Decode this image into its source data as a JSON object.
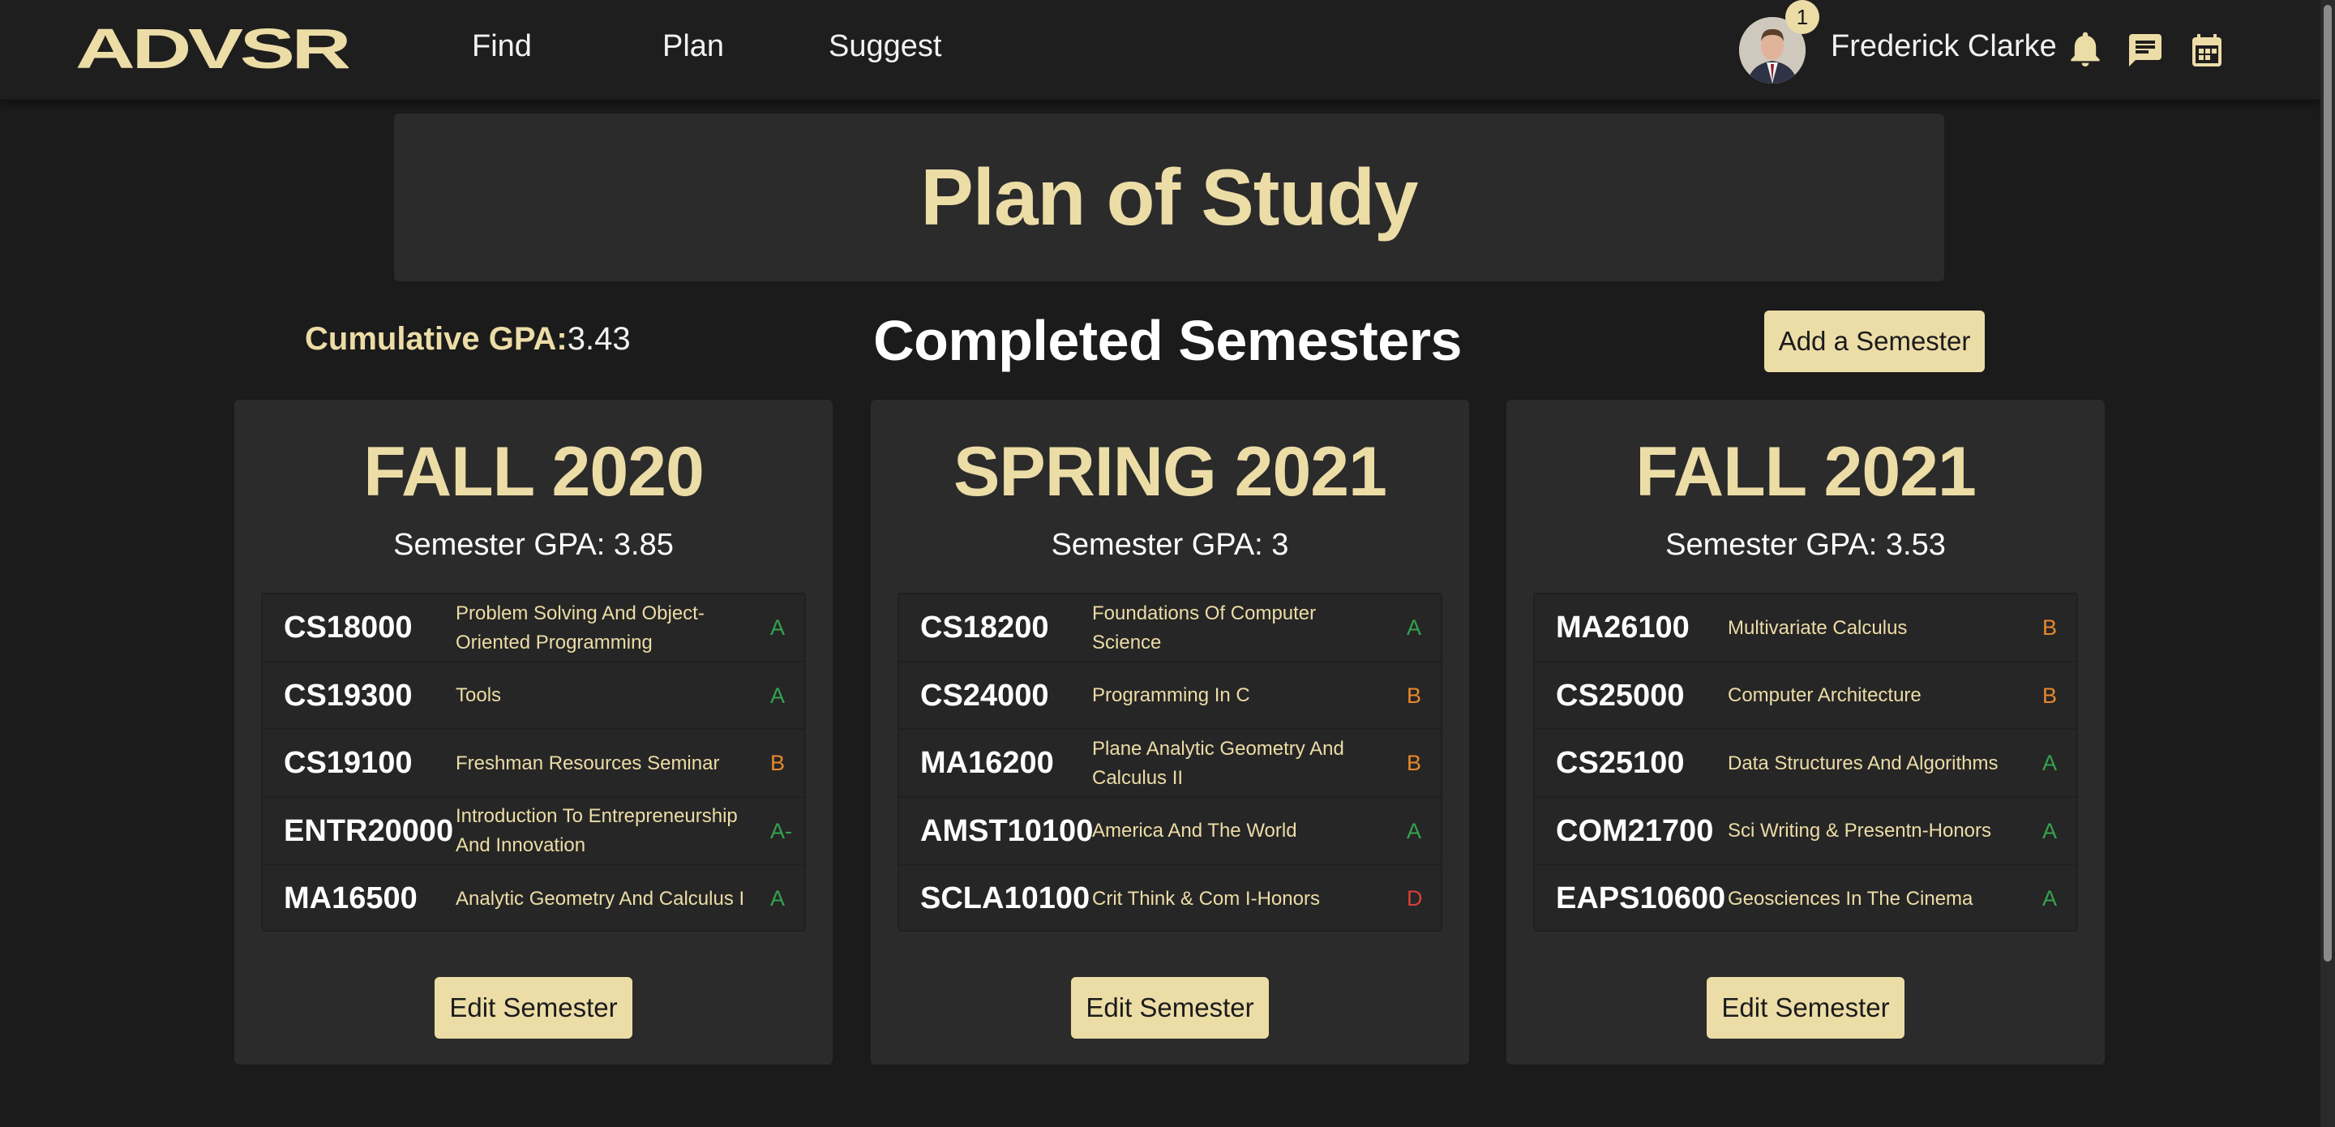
{
  "app": {
    "logo_text": "ADVSR"
  },
  "nav": {
    "find": "Find",
    "plan": "Plan",
    "suggest": "Suggest"
  },
  "user": {
    "name": "Frederick Clarke",
    "notification_count": "1"
  },
  "header_icons": [
    "bell-icon",
    "chat-icon",
    "calendar-icon"
  ],
  "page": {
    "title": "Plan of Study",
    "cumulative_gpa_label": "Cumulative GPA:",
    "cumulative_gpa_value": "3.43",
    "section_heading": "Completed Semesters",
    "add_semester_label": "Add a Semester",
    "edit_semester_label": "Edit Semester"
  },
  "colors": {
    "accent": "#ecdca6",
    "background": "#1b1b1b",
    "panel": "#2b2b2b",
    "grade_good": "#35a34f",
    "grade_mid": "#e8882c",
    "grade_bad": "#d6403a"
  },
  "semesters": [
    {
      "title": "FALL 2020",
      "gpa_text": "Semester GPA: 3.85",
      "courses": [
        {
          "code": "CS18000",
          "name": "Problem Solving And Object-Oriented Programming",
          "grade": "A"
        },
        {
          "code": "CS19300",
          "name": "Tools",
          "grade": "A"
        },
        {
          "code": "CS19100",
          "name": "Freshman Resources Seminar",
          "grade": "B"
        },
        {
          "code": "ENTR20000",
          "name": "Introduction To Entrepreneurship And Innovation",
          "grade": "A-"
        },
        {
          "code": "MA16500",
          "name": "Analytic Geometry And Calculus I",
          "grade": "A"
        }
      ]
    },
    {
      "title": "SPRING 2021",
      "gpa_text": "Semester GPA: 3",
      "courses": [
        {
          "code": "CS18200",
          "name": "Foundations Of Computer Science",
          "grade": "A"
        },
        {
          "code": "CS24000",
          "name": "Programming In C",
          "grade": "B"
        },
        {
          "code": "MA16200",
          "name": "Plane Analytic Geometry And Calculus II",
          "grade": "B"
        },
        {
          "code": "AMST10100",
          "name": "America And The World",
          "grade": "A"
        },
        {
          "code": "SCLA10100",
          "name": "Crit Think & Com I-Honors",
          "grade": "D"
        }
      ]
    },
    {
      "title": "FALL 2021",
      "gpa_text": "Semester GPA: 3.53",
      "courses": [
        {
          "code": "MA26100",
          "name": "Multivariate Calculus",
          "grade": "B"
        },
        {
          "code": "CS25000",
          "name": "Computer Architecture",
          "grade": "B"
        },
        {
          "code": "CS25100",
          "name": "Data Structures And Algorithms",
          "grade": "A"
        },
        {
          "code": "COM21700",
          "name": "Sci Writing & Presentn-Honors",
          "grade": "A"
        },
        {
          "code": "EAPS10600",
          "name": "Geosciences In The Cinema",
          "grade": "A"
        }
      ]
    }
  ]
}
